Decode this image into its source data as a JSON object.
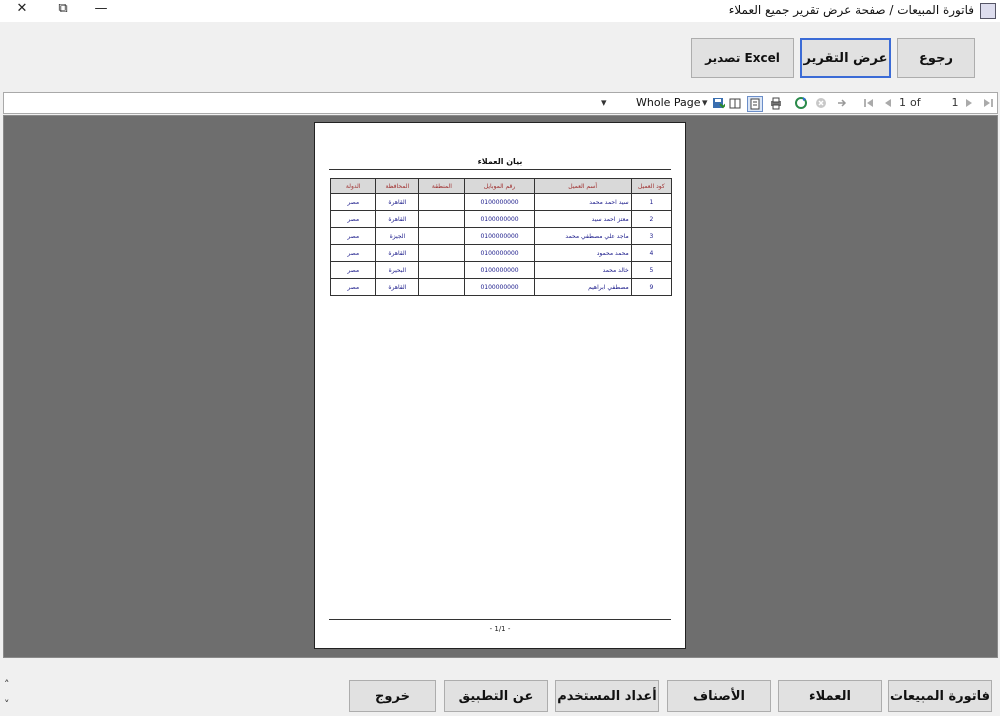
{
  "window": {
    "title": "فاتورة المبيعات / صفحة عرض تقرير جميع العملاء",
    "close_glyph": "✕",
    "restore_glyph": "⧉",
    "minimize_glyph": "—"
  },
  "top_buttons": {
    "back": "رجوع",
    "show_report": "عرض التقرير",
    "export_excel": "تصدير Excel"
  },
  "toolbar": {
    "zoom_value": "Whole Page",
    "dropdown_glyph": "▾",
    "page_current": "1",
    "page_of": "of",
    "page_total": "1",
    "icons": [
      "first-page-icon",
      "prev-page-icon",
      "next-page-icon",
      "last-page-icon",
      "back-icon",
      "stop-icon",
      "refresh-icon",
      "print-icon",
      "print-layout-icon",
      "page-setup-icon",
      "export-icon"
    ]
  },
  "report": {
    "title": "بيان العملاء",
    "columns": [
      "كود العميل",
      "أسم العميل",
      "رقم الموبايل",
      "المنطقة",
      "المحافظة",
      "الدولة"
    ],
    "rows": [
      [
        "1",
        "سيد احمد محمد",
        "0100000000",
        "",
        "القاهرة",
        "مصر"
      ],
      [
        "2",
        "معتز احمد سيد",
        "0100000000",
        "",
        "القاهرة",
        "مصر"
      ],
      [
        "3",
        "ماجد علي مصطفي محمد",
        "0100000000",
        "",
        "الجيزة",
        "مصر"
      ],
      [
        "4",
        "محمد محمود",
        "0100000000",
        "",
        "القاهرة",
        "مصر"
      ],
      [
        "5",
        "خالد محمد",
        "0100000000",
        "",
        "البحيرة",
        "مصر"
      ],
      [
        "9",
        "مصطفي ابراهيم",
        "0100000000",
        "",
        "القاهرة",
        "مصر"
      ]
    ],
    "page_number": "- 1/1 -"
  },
  "bottom_buttons": {
    "sales_invoice": "فاتورة المبيعات",
    "customers": "العملاء",
    "items": "الأصناف",
    "user_settings": "أعداد المستخدم",
    "about": "عن التطبيق",
    "exit": "خروج"
  },
  "scroll": {
    "up": "˄",
    "down": "˅"
  }
}
